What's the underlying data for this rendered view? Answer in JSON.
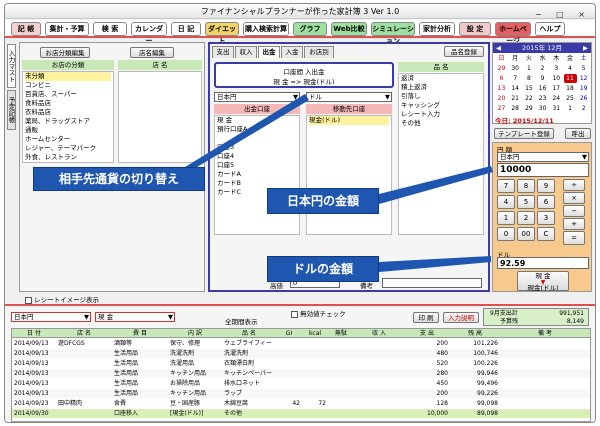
{
  "window": {
    "title": "ファイナンシャルプランナーが作った家計簿 3 Ver 1.0",
    "controls": "− □ ×"
  },
  "menu": [
    {
      "label": "記 帳",
      "bg": "#f6d0d0"
    },
    {
      "label": "集計・予算",
      "bg": "#ffffff"
    },
    {
      "label": "検 索",
      "bg": "#ffffff"
    },
    {
      "label": "カレンダー",
      "bg": "#ffffff"
    },
    {
      "label": "日 記",
      "bg": "#ffffff"
    },
    {
      "label": "ダイエット",
      "bg": "#f4d36a"
    },
    {
      "label": "購入検索計算",
      "bg": "#ffffff"
    },
    {
      "label": "グラフ",
      "bg": "#9ee09e"
    },
    {
      "label": "Web比較",
      "bg": "#9ee09e"
    },
    {
      "label": "シミュレーション",
      "bg": "#9ee09e"
    },
    {
      "label": "家計分析",
      "bg": "#ffffff"
    },
    {
      "label": "設 定",
      "bg": "#f6c9c9"
    },
    {
      "label": "ホームページ",
      "bg": "#e56060"
    },
    {
      "label": "ヘルプ",
      "bg": "#ffffff"
    }
  ],
  "side_tabs": [
    "入力マスト",
    "予定記帳"
  ],
  "shop_panel": {
    "btn_category_edit": "お店分類編集",
    "btn_shop_edit": "店名編集",
    "hdr_category": "お店の分類",
    "hdr_shop": "店 名",
    "categories": [
      "未分類",
      "コンビニ",
      "百貨店、スーパー",
      "食料品店",
      "衣料品店",
      "薬局、ドラッグストア",
      "通販",
      "ホームセンター",
      "レジャー、テーマパーク",
      "外食、レストラン"
    ]
  },
  "entry_panel": {
    "tabs": [
      "支出",
      "収入",
      "出金",
      "入金",
      "お店別"
    ],
    "btn_item_register": "品名登録",
    "box_title": "口座間 入出金",
    "box_desc": "現 金 => 現金(ドル)",
    "from_currency": "日本円",
    "to_currency": "ドル",
    "from_hdr": "出金口座",
    "to_hdr": "移動先口座",
    "from_accounts": [
      "現 金",
      "預行口座A",
      "",
      "口座3",
      "口座4",
      "口座5",
      "カードA",
      "カードB",
      "カードC"
    ],
    "to_accounts": [
      "現金(ドル)"
    ],
    "item_hdr": "品 名",
    "items": [
      "返済",
      "積上返済",
      "引落し",
      "キャッシング",
      "レシート入力",
      "その他"
    ],
    "label_amount": "高値",
    "amount_value": "0",
    "label_note": "備考"
  },
  "calendar": {
    "header": "2015年 12月",
    "weekdays": [
      "日",
      "月",
      "火",
      "水",
      "木",
      "金",
      "土"
    ],
    "weeks": [
      [
        "29",
        "30",
        "1",
        "2",
        "3",
        "4",
        "5"
      ],
      [
        "6",
        "7",
        "8",
        "9",
        "10",
        "11",
        "12"
      ],
      [
        "13",
        "14",
        "15",
        "16",
        "17",
        "18",
        "19"
      ],
      [
        "20",
        "21",
        "22",
        "23",
        "24",
        "25",
        "26"
      ],
      [
        "27",
        "28",
        "29",
        "30",
        "31",
        "1",
        "2"
      ]
    ],
    "today_label": "今日: 2015/12/11"
  },
  "right_panel": {
    "btn_template": "テンプレート登録",
    "btn_call": "呼出",
    "hdr_yen": "円 額",
    "currency": "日本円",
    "yen_value": "10000",
    "keys": [
      [
        "7",
        "8",
        "9"
      ],
      [
        "4",
        "5",
        "6"
      ],
      [
        "1",
        "2",
        "3"
      ],
      [
        "0",
        "00",
        "C"
      ]
    ],
    "ops": [
      "÷",
      "×",
      "−",
      "+",
      "="
    ],
    "label_dollar": "ドル",
    "dollar_value": "92.59",
    "btn_record_top": "現 金",
    "btn_record_bottom": "現金(ドル)"
  },
  "callouts": {
    "toggle": "相手先通貨の切り替え",
    "yen": "日本円の金額",
    "dollar": "ドルの金額"
  },
  "receipt_checkbox": "レシートイメージ表示",
  "bottom": {
    "currency": "日本円",
    "account": "現 金",
    "period": "全期間表示",
    "zero_check": "無効値チェック",
    "btn_print": "印 刷",
    "btn_input_explain": "入力説明",
    "summary_left_1": "9月支出計",
    "summary_right_1": "991,951",
    "summary_left_2": "予算残",
    "summary_right_2": "8,149",
    "columns": [
      "日 付",
      "店 名",
      "費 目",
      "内 訳",
      "品 名",
      "GI",
      "kcal",
      "無駄",
      "収 入",
      "支 出",
      "残 高",
      "備 考"
    ],
    "rows": [
      [
        "2014/09/13",
        "遊DFCGS",
        "酒類等",
        "保守、修理",
        "ウェブライフィー",
        "",
        "",
        "",
        "",
        "200",
        "101,226",
        ""
      ],
      [
        "2014/09/13",
        "",
        "生活用品",
        "洗濯洗剤",
        "洗濯洗剤",
        "",
        "",
        "",
        "",
        "480",
        "100,746",
        ""
      ],
      [
        "2014/09/13",
        "",
        "生活用品",
        "洗濯用品",
        "衣類漂白剤",
        "",
        "",
        "",
        "",
        "520",
        "100,226",
        ""
      ],
      [
        "2014/09/13",
        "",
        "生活用品",
        "キッチン用品",
        "キッチンペーパー",
        "",
        "",
        "",
        "",
        "280",
        "99,946",
        ""
      ],
      [
        "2014/09/13",
        "",
        "生活用品",
        "お掃除用品",
        "排水口ネット",
        "",
        "",
        "",
        "",
        "450",
        "99,496",
        ""
      ],
      [
        "2014/09/13",
        "",
        "生活用品",
        "キッチン用品",
        "ラップ",
        "",
        "",
        "",
        "",
        "200",
        "99,226",
        ""
      ],
      [
        "2014/09/23",
        "田中精肉",
        "食費",
        "豆・国産豚",
        "木綿豆腐",
        "42",
        "72",
        "",
        "",
        "128",
        "99,098",
        ""
      ],
      [
        "2014/09/30",
        "",
        "口座移入",
        "[現金(ドル)]",
        "その他",
        "",
        "",
        "",
        "",
        "10,000",
        "89,098",
        ""
      ]
    ]
  },
  "colors": {
    "accent_red": "#e05050",
    "callout_blue": "#1e56b0",
    "purple_border": "#3a3aa8",
    "green_header": "#c8e8b8",
    "pink_header": "#f5b8b8",
    "orange_panel": "#f7c98c"
  }
}
